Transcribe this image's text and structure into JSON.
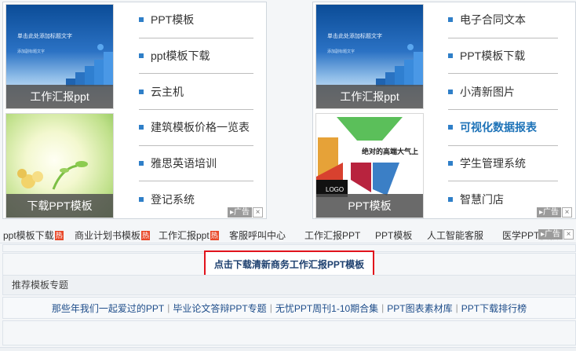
{
  "left_ad": {
    "thumbs": [
      {
        "caption": "工作汇报ppt",
        "tiny_title": "单击此处添加标题文字",
        "tiny_sub": "添加副标题文字"
      },
      {
        "caption": "下载PPT模板"
      }
    ],
    "links": [
      "PPT模板",
      "ppt模板下载",
      "云主机",
      "建筑模板价格一览表",
      "雅思英语培训",
      "登记系统"
    ]
  },
  "right_ad": {
    "thumbs": [
      {
        "caption": "工作汇报ppt",
        "tiny_title": "单击此处添加标题文字",
        "tiny_sub": "添加副标题文字"
      },
      {
        "caption": "PPT模板",
        "slogan": "绝对的高端大气上",
        "logo": "LOGO"
      }
    ],
    "links": [
      "电子合同文本",
      "PPT模板下载",
      "小清新图片",
      "可视化数据报表",
      "学生管理系统",
      "智慧门店"
    ],
    "highlight_index": 3
  },
  "ad_label": "广告",
  "ad_close": "×",
  "keyword_bar": {
    "items": [
      {
        "text": "ppt模板下载",
        "hot": "热"
      },
      {
        "text": "商业计划书模板",
        "hot": "热"
      },
      {
        "text": "工作汇报ppt",
        "hot": "热"
      },
      {
        "text": "客服呼叫中心",
        "hot": ""
      },
      {
        "text": "工作汇报PPT",
        "hot": ""
      },
      {
        "text": "PPT模板",
        "hot": ""
      },
      {
        "text": "人工智能客服",
        "hot": ""
      },
      {
        "text": "医学PPT模板",
        "hot": ""
      }
    ]
  },
  "cta_label": "点击下载清新商务工作汇报PPT模板",
  "section_title": "推荐模板专题",
  "topics": [
    "那些年我们一起爱过的PPT",
    "毕业论文答辩PPT专题",
    "无忧PPT周刊1-10期合集",
    "PPT图表素材库",
    "PPT下载排行榜"
  ],
  "topic_separator": "|",
  "colors": {
    "accent_blue": "#2f7fc8",
    "hot_red": "#e8492a",
    "cta_border": "#e1131c"
  },
  "icons": [
    "ad-info-icon",
    "close-icon"
  ]
}
